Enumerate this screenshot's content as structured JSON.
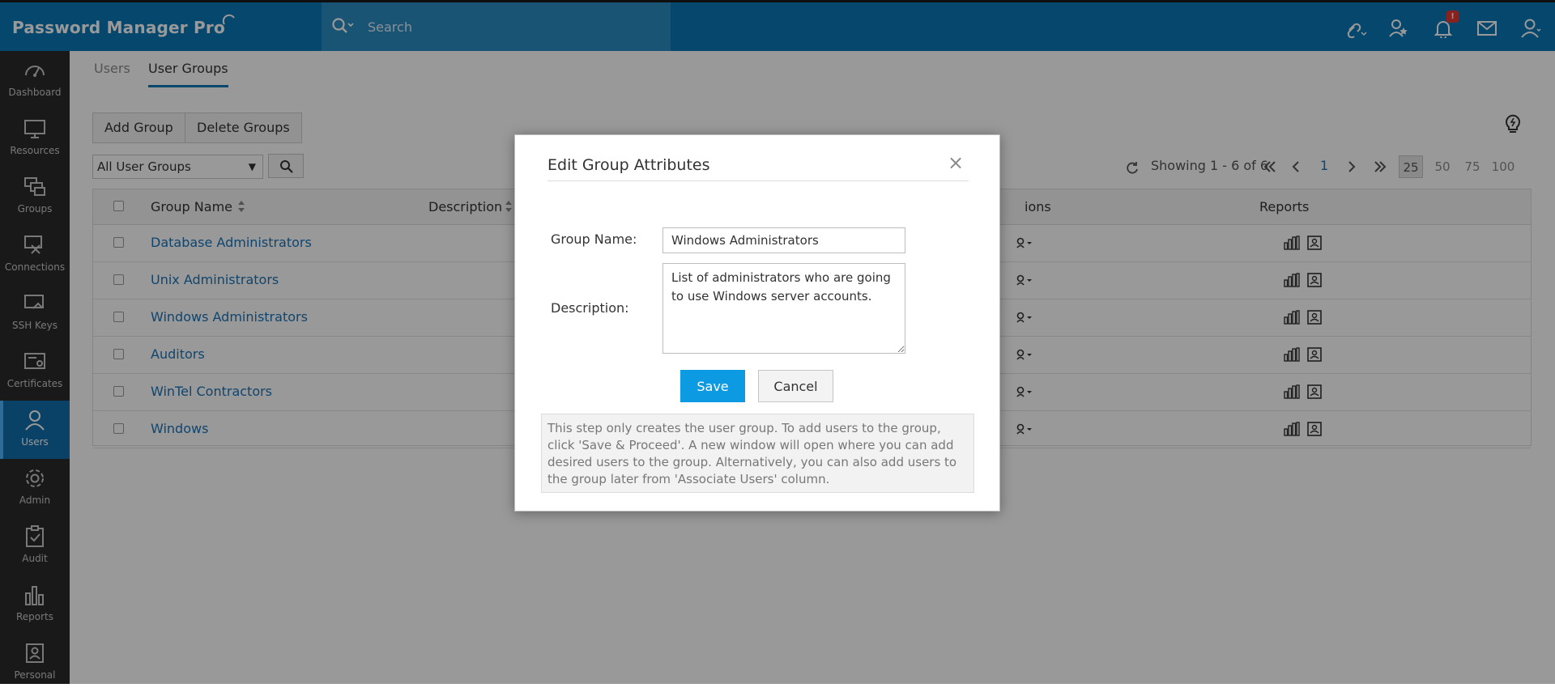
{
  "app": {
    "title": "Password Manager Pro",
    "search_placeholder": "Search",
    "notification_count": "!",
    "colors": {
      "brand": "#0a78b6",
      "sidebar": "#2a2a2a",
      "link": "#1a73b8",
      "primary_button": "#0c9be3"
    }
  },
  "top_icons": [
    "link-icon",
    "star-user-icon",
    "bell-icon",
    "mail-icon",
    "user-icon"
  ],
  "sidebar": {
    "items": [
      {
        "label": "Dashboard",
        "icon": "gauge-icon"
      },
      {
        "label": "Resources",
        "icon": "monitor-icon"
      },
      {
        "label": "Groups",
        "icon": "groups-icon"
      },
      {
        "label": "Connections",
        "icon": "connections-icon"
      },
      {
        "label": "SSH Keys",
        "icon": "ssh-key-icon"
      },
      {
        "label": "Certificates",
        "icon": "certificate-icon"
      },
      {
        "label": "Users",
        "icon": "user-icon",
        "active": true
      },
      {
        "label": "Admin",
        "icon": "gear-icon"
      },
      {
        "label": "Audit",
        "icon": "clipboard-check-icon"
      },
      {
        "label": "Reports",
        "icon": "bar-chart-icon"
      },
      {
        "label": "Personal",
        "icon": "personal-icon"
      }
    ]
  },
  "tabs": [
    {
      "label": "Users",
      "active": false
    },
    {
      "label": "User Groups",
      "active": true
    }
  ],
  "toolbar": {
    "add_group": "Add Group",
    "delete_groups": "Delete Groups",
    "group_filter": "All User Groups"
  },
  "pagination": {
    "showing": "Showing 1 - 6 of 6",
    "current_page": "1",
    "page_sizes": [
      "25",
      "50",
      "75",
      "100"
    ],
    "selected_page_size": "25"
  },
  "table": {
    "headers": {
      "group_name": "Group Name",
      "description": "Description",
      "associate": "ions",
      "reports": "Reports"
    },
    "rows": [
      {
        "name": "Database Administrators"
      },
      {
        "name": "Unix Administrators"
      },
      {
        "name": "Windows Administrators"
      },
      {
        "name": "Auditors"
      },
      {
        "name": "WinTel Contractors"
      },
      {
        "name": "Windows"
      }
    ]
  },
  "modal": {
    "title": "Edit Group Attributes",
    "close_glyph": "×",
    "group_name_label": "Group Name:",
    "group_name_value": "Windows Administrators",
    "description_label": "Description:",
    "description_value": "List of administrators who are going to use Windows server accounts.",
    "save_label": "Save",
    "cancel_label": "Cancel",
    "info_text": "This step only creates the user group. To add users to the group, click 'Save & Proceed'. A new window will open where you can add desired users to the group. Alternatively, you can also add users to the group later from 'Associate Users' column."
  }
}
